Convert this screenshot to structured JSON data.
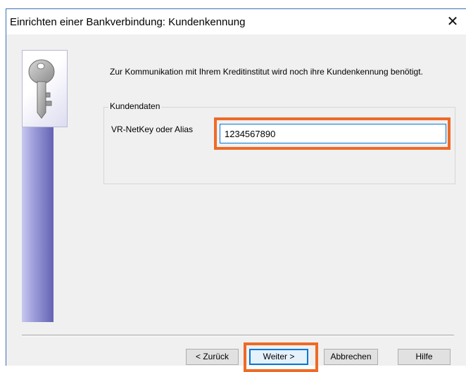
{
  "window": {
    "title": "Einrichten einer Bankverbindung: Kundenkennung",
    "close_glyph": "✕"
  },
  "intro": {
    "text": "Zur Kommunikation mit Ihrem Kreditinstitut wird noch ihre Kundenkennung benötigt."
  },
  "group": {
    "legend": "Kundendaten",
    "field_label": "VR-NetKey oder Alias",
    "field_value": "1234567890"
  },
  "buttons": {
    "back": "< Zurück",
    "next": "Weiter >",
    "cancel": "Abbrechen",
    "help": "Hilfe"
  },
  "icons": {
    "wizard_graphic": "key-icon"
  },
  "colors": {
    "highlight": "#ee6a26",
    "focus": "#0078d7",
    "sidebar_gradient": [
      "#c9c9ef",
      "#6363b3"
    ]
  }
}
